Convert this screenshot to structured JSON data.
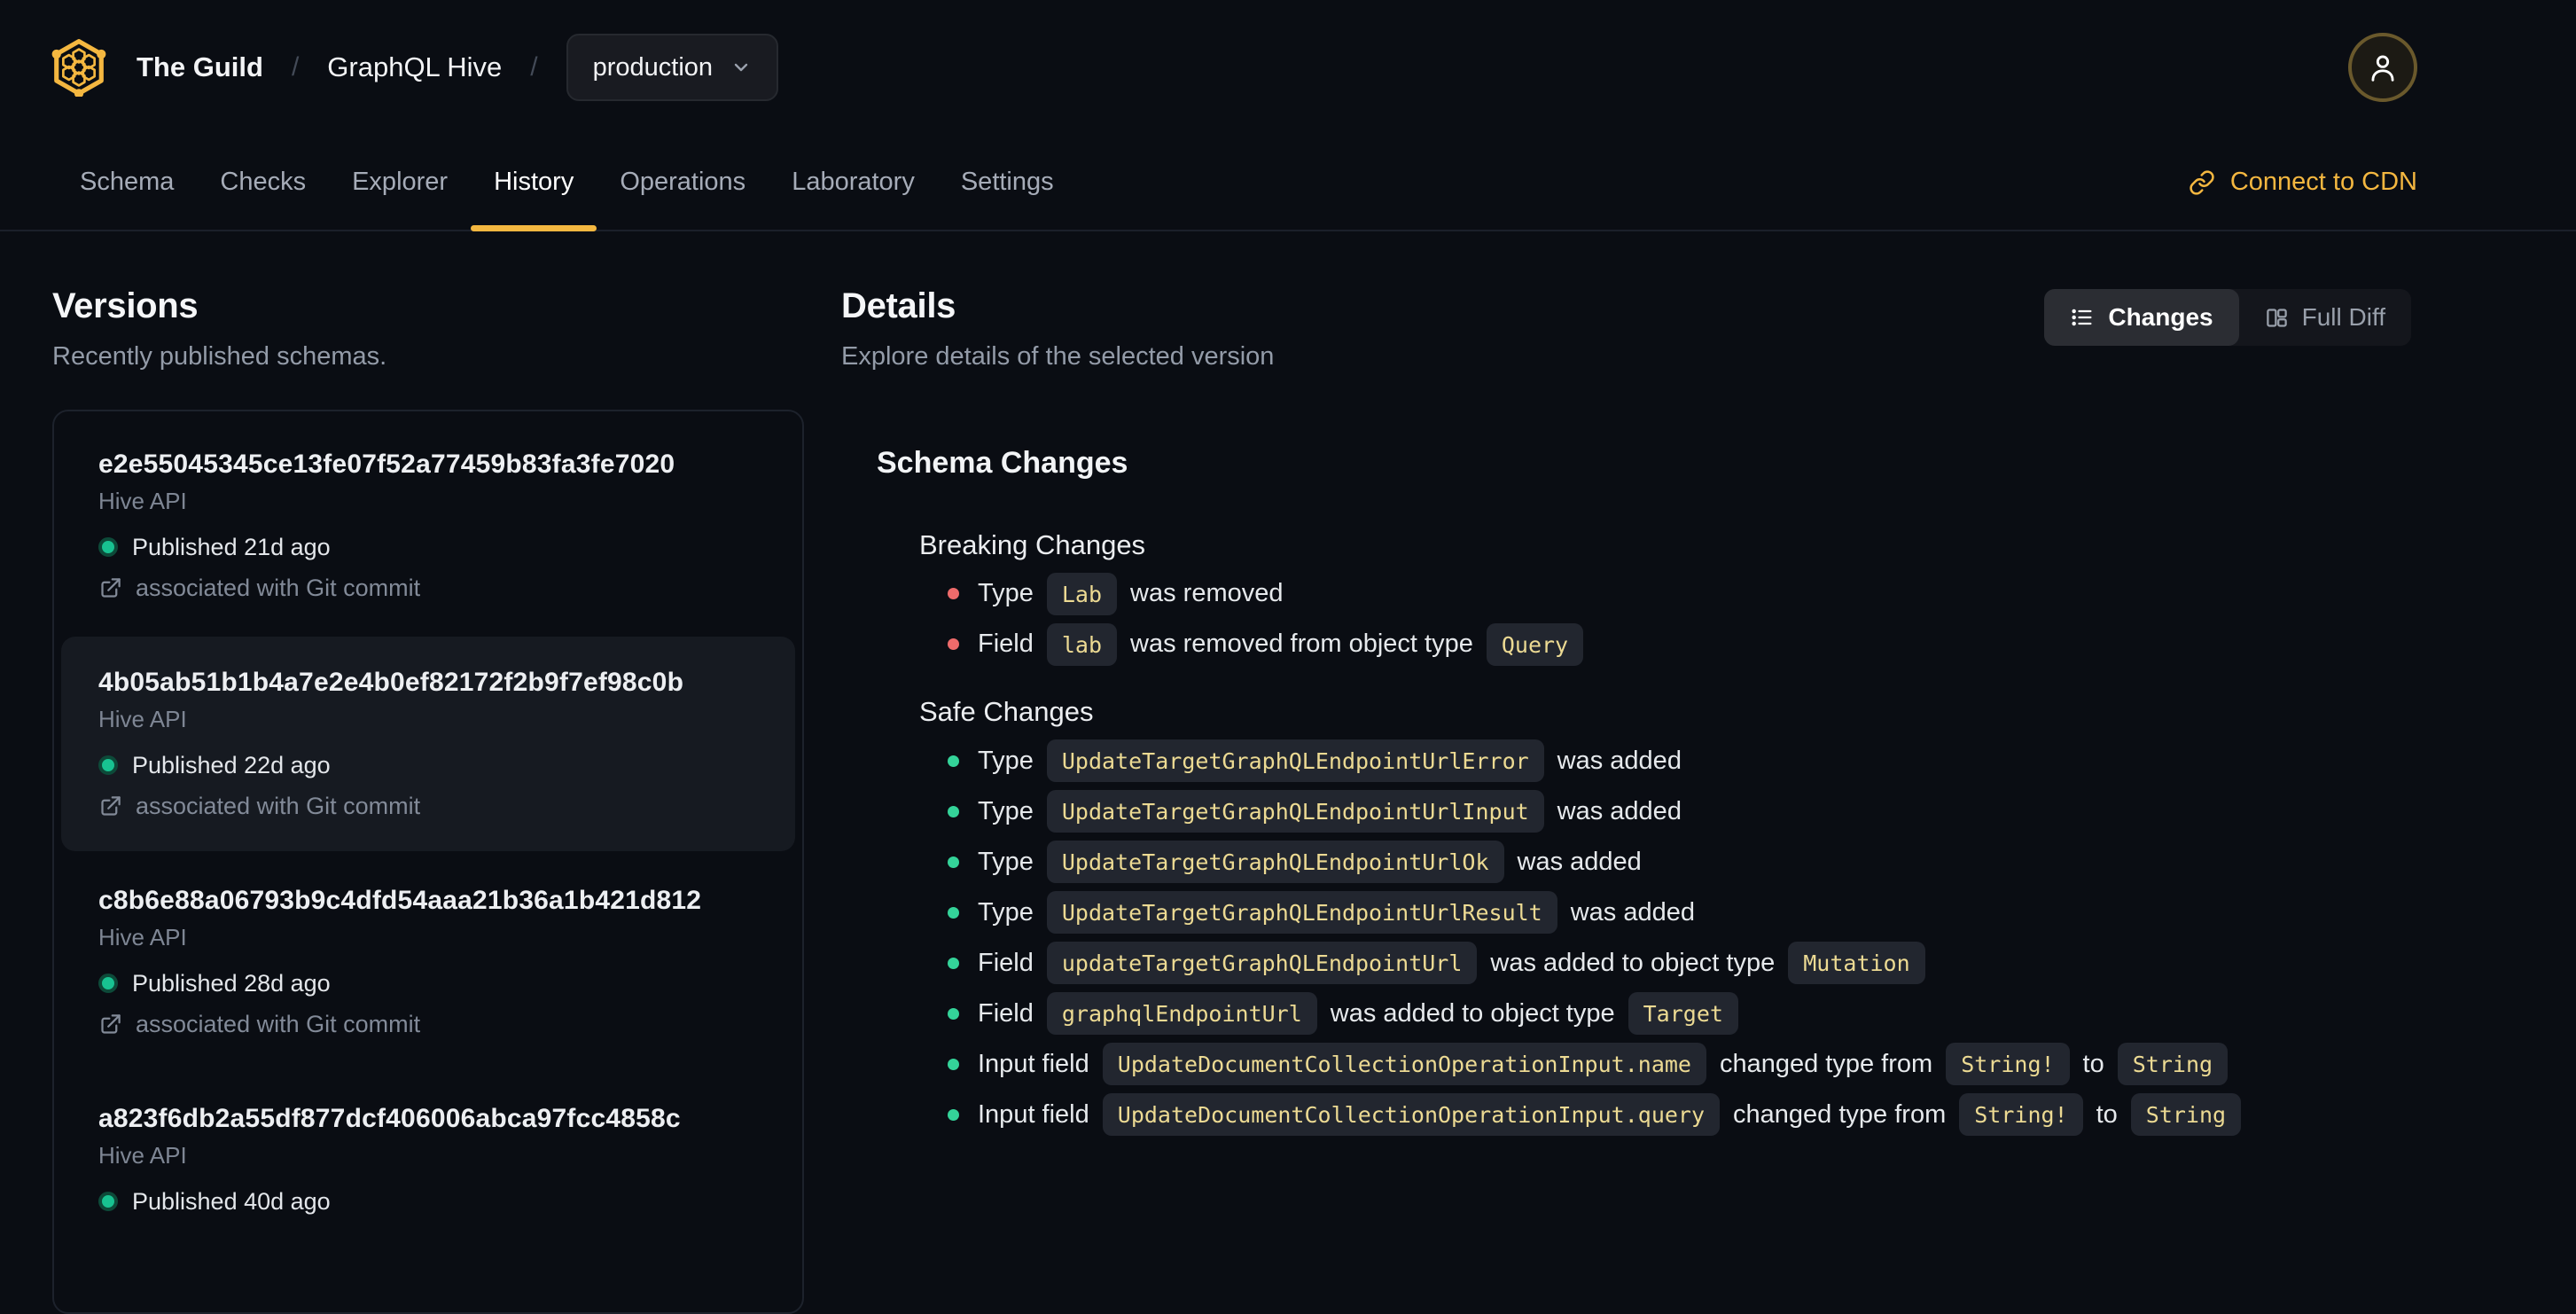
{
  "colors": {
    "accent_gold": "#f4b740",
    "page_bg": "#0a0d13",
    "selected_card_bg": "#161a21",
    "chip_bg": "#22262f",
    "chip_text": "#ecda93",
    "breaking_bullet": "#ee6b6b",
    "safe_bullet": "#34d399",
    "published_dot": "#18c291"
  },
  "header": {
    "logo": "graphql-hive-honeycomb",
    "breadcrumb": {
      "separator": "/",
      "org": "The Guild",
      "project": "GraphQL Hive",
      "target": "production"
    },
    "tabs": [
      {
        "label": "Schema",
        "active": false
      },
      {
        "label": "Checks",
        "active": false
      },
      {
        "label": "Explorer",
        "active": false
      },
      {
        "label": "History",
        "active": true
      },
      {
        "label": "Operations",
        "active": false
      },
      {
        "label": "Laboratory",
        "active": false
      },
      {
        "label": "Settings",
        "active": false
      }
    ],
    "connect_cdn_label": "Connect to CDN"
  },
  "versions": {
    "title": "Versions",
    "subtitle": "Recently published schemas.",
    "items": [
      {
        "hash": "e2e55045345ce13fe07f52a77459b83fa3fe7020",
        "service": "Hive API",
        "status": "Published 21d ago",
        "git": "associated with Git commit",
        "selected": false
      },
      {
        "hash": "4b05ab51b1b4a7e2e4b0ef82172f2b9f7ef98c0b",
        "service": "Hive API",
        "status": "Published 22d ago",
        "git": "associated with Git commit",
        "selected": true
      },
      {
        "hash": "c8b6e88a06793b9c4dfd54aaa21b36a1b421d812",
        "service": "Hive API",
        "status": "Published 28d ago",
        "git": "associated with Git commit",
        "selected": false
      },
      {
        "hash": "a823f6db2a55df877dcf406006abca97fcc4858c",
        "service": "Hive API",
        "status": "Published 40d ago",
        "git": null,
        "selected": false
      }
    ]
  },
  "details": {
    "title": "Details",
    "subtitle": "Explore details of the selected version",
    "view_toggle": [
      {
        "label": "Changes",
        "icon": "list-icon",
        "active": true
      },
      {
        "label": "Full Diff",
        "icon": "columns-icon",
        "active": false
      }
    ],
    "schema_changes": {
      "title": "Schema Changes",
      "sections": [
        {
          "title": "Breaking Changes",
          "severity": "breaking",
          "items": [
            [
              {
                "text": "Type"
              },
              {
                "code": "Lab"
              },
              {
                "text": "was removed"
              }
            ],
            [
              {
                "text": "Field"
              },
              {
                "code": "lab"
              },
              {
                "text": "was removed from object type"
              },
              {
                "code": "Query"
              }
            ]
          ]
        },
        {
          "title": "Safe Changes",
          "severity": "safe",
          "items": [
            [
              {
                "text": "Type"
              },
              {
                "code": "UpdateTargetGraphQLEndpointUrlError"
              },
              {
                "text": "was added"
              }
            ],
            [
              {
                "text": "Type"
              },
              {
                "code": "UpdateTargetGraphQLEndpointUrlInput"
              },
              {
                "text": "was added"
              }
            ],
            [
              {
                "text": "Type"
              },
              {
                "code": "UpdateTargetGraphQLEndpointUrlOk"
              },
              {
                "text": "was added"
              }
            ],
            [
              {
                "text": "Type"
              },
              {
                "code": "UpdateTargetGraphQLEndpointUrlResult"
              },
              {
                "text": "was added"
              }
            ],
            [
              {
                "text": "Field"
              },
              {
                "code": "updateTargetGraphQLEndpointUrl"
              },
              {
                "text": "was added to object type"
              },
              {
                "code": "Mutation"
              }
            ],
            [
              {
                "text": "Field"
              },
              {
                "code": "graphqlEndpointUrl"
              },
              {
                "text": "was added to object type"
              },
              {
                "code": "Target"
              }
            ],
            [
              {
                "text": "Input field"
              },
              {
                "code": "UpdateDocumentCollectionOperationInput.name"
              },
              {
                "text": "changed type from"
              },
              {
                "code": "String!"
              },
              {
                "text": "to"
              },
              {
                "code": "String"
              }
            ],
            [
              {
                "text": "Input field"
              },
              {
                "code": "UpdateDocumentCollectionOperationInput.query"
              },
              {
                "text": "changed type from"
              },
              {
                "code": "String!"
              },
              {
                "text": "to"
              },
              {
                "code": "String"
              }
            ]
          ]
        }
      ]
    }
  }
}
